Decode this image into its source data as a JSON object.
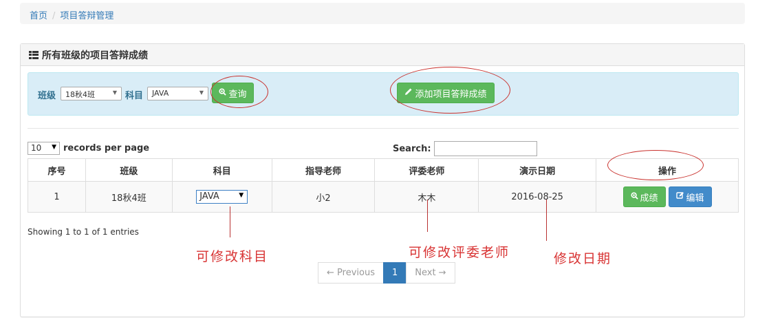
{
  "breadcrumb": {
    "home": "首页",
    "separator": "/",
    "current": "项目答辩管理"
  },
  "panel": {
    "title": "所有班级的项目答辩成绩"
  },
  "filter": {
    "class_label": "班级",
    "class_value": "18秋4班",
    "subject_label": "科目",
    "subject_value": "JAVA",
    "query_button": "查询",
    "add_button": "添加项目答辩成绩"
  },
  "table_controls": {
    "page_length": "10",
    "records_per_page": "records per page",
    "search_label": "Search:",
    "search_value": ""
  },
  "table": {
    "columns": [
      "序号",
      "班级",
      "科目",
      "指导老师",
      "评委老师",
      "演示日期",
      "操作"
    ],
    "rows": [
      {
        "index": "1",
        "class": "18秋4班",
        "subject": "JAVA",
        "advisor": "小2",
        "judge": "木木",
        "date": "2016-08-25",
        "grade_button": "成绩",
        "edit_button": "编辑"
      }
    ]
  },
  "info": "Showing 1 to 1 of 1 entries",
  "pagination": {
    "previous": "← Previous",
    "current": "1",
    "next": "Next →"
  },
  "annotations": {
    "subject": "可修改科目",
    "judge": "可修改评委老师",
    "date": "修改日期"
  },
  "colors": {
    "success": "#5cb85c",
    "primary": "#428bca",
    "link": "#337ab7",
    "info_bg": "#d9edf7",
    "annotation": "#d83333"
  }
}
